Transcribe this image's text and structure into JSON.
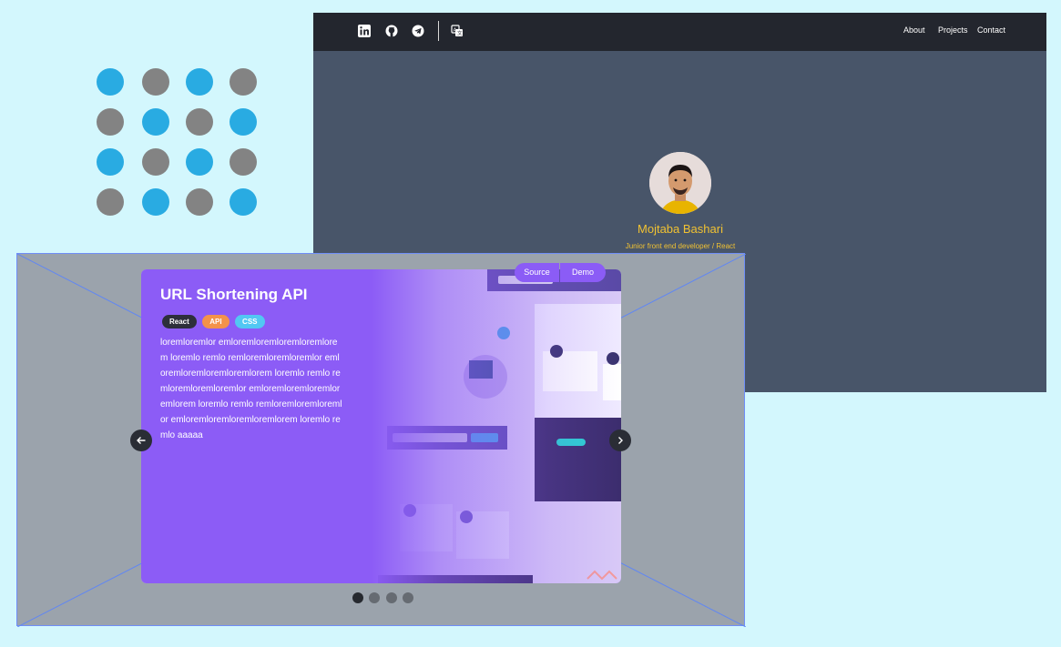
{
  "colors": {
    "page_background": "#d3f7fd",
    "dot_blue": "#29abe2",
    "dot_gray": "#838383",
    "navbar": "#23262e",
    "hero_background": "#485569",
    "accent_yellow": "#f1c232",
    "card_purple": "#8c5cf6",
    "overlay_gray": "#9ba3ac"
  },
  "nav": {
    "icons": [
      "linkedin-icon",
      "github-icon",
      "telegram-icon",
      "translate-icon"
    ],
    "links": [
      "About",
      "Projects",
      "Contact"
    ]
  },
  "profile": {
    "name": "Mojtaba Bashari",
    "role": "Junior front end developer / React"
  },
  "project": {
    "title": "URL Shortening API",
    "tags": [
      "React",
      "API",
      "CSS"
    ],
    "description": "loremloremlor emloremloremloremloremlorem loremlo remlo remloremloremloremlor emloremloremloremloremlorem loremlo remlo remloremloremloremlor emloremloremloremloremlorem loremlo remlo remloremloremloremlor emloremloremloremloremlorem loremlo remlo aaaaa",
    "source_label": "Source",
    "demo_label": "Demo"
  },
  "carousel": {
    "prev_icon": "arrow-left-icon",
    "next_icon": "arrow-right-icon",
    "slide_count": 4,
    "active_slide": 1
  }
}
